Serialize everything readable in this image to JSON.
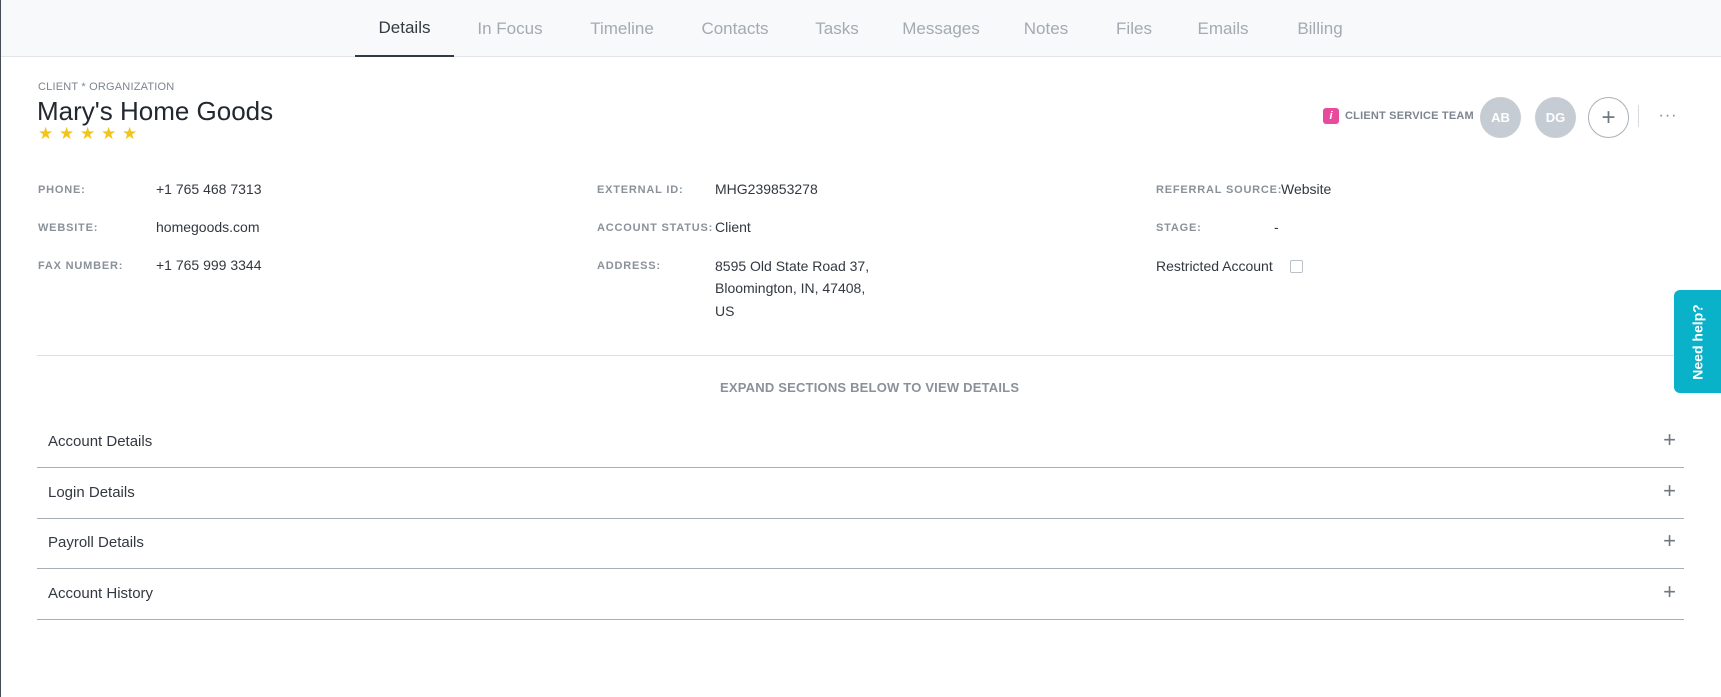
{
  "tabs": [
    {
      "label": "Details",
      "active": true
    },
    {
      "label": "In Focus",
      "active": false
    },
    {
      "label": "Timeline",
      "active": false
    },
    {
      "label": "Contacts",
      "active": false
    },
    {
      "label": "Tasks",
      "active": false
    },
    {
      "label": "Messages",
      "active": false
    },
    {
      "label": "Notes",
      "active": false
    },
    {
      "label": "Files",
      "active": false
    },
    {
      "label": "Emails",
      "active": false
    },
    {
      "label": "Billing",
      "active": false
    }
  ],
  "header": {
    "entity_type": "CLIENT * ORGANIZATION",
    "name": "Mary's Home Goods",
    "rating": 5,
    "rating_max": 5,
    "team_icon": "info-icon",
    "team_label": "CLIENT SERVICE TEAM",
    "avatars": [
      "AB",
      "DG"
    ],
    "add_member_glyph": "+",
    "more_glyph": "···"
  },
  "fields": {
    "phone": {
      "label": "PHONE:",
      "value": "+1 765 468 7313"
    },
    "website": {
      "label": "WEBSITE:",
      "value": "homegoods.com"
    },
    "fax": {
      "label": "FAX NUMBER:",
      "value": "+1 765 999 3344"
    },
    "external_id": {
      "label": "EXTERNAL ID:",
      "value": "MHG239853278"
    },
    "account_status": {
      "label": "ACCOUNT STATUS:",
      "value": "Client"
    },
    "address": {
      "label": "ADDRESS:",
      "line1": "8595 Old State Road 37,",
      "line2": "Bloomington, IN, 47408,",
      "line3": "US"
    },
    "referral_source": {
      "label": "REFERRAL SOURCE:",
      "value": "Website"
    },
    "stage": {
      "label": "STAGE:",
      "value": "-"
    },
    "restricted": {
      "label": "Restricted Account",
      "checked": false
    }
  },
  "expand_hint": "EXPAND SECTIONS BELOW TO VIEW DETAILS",
  "sections": [
    {
      "title": "Account Details"
    },
    {
      "title": "Login Details"
    },
    {
      "title": "Payroll Details"
    },
    {
      "title": "Account History"
    }
  ],
  "help_tab": "Need help?",
  "colors": {
    "star": "#f2c618",
    "team_icon_bg": "#e84b9b",
    "help_tab_bg": "#09b1c9",
    "avatar_bg": "#c6ccd3"
  }
}
